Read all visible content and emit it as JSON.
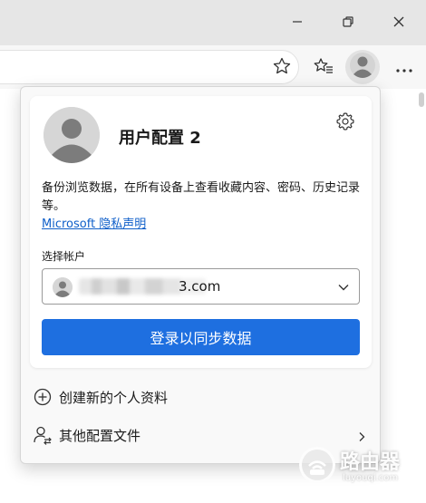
{
  "window": {
    "minimize_icon": "minimize-icon",
    "restore_icon": "restore-icon",
    "close_icon": "close-icon"
  },
  "toolbar": {
    "favorite_icon": "star-icon",
    "favorites_list_icon": "favorites-list-icon",
    "profile_icon": "avatar-icon",
    "more_icon": "more-icon"
  },
  "profile_panel": {
    "profile_name": "用户配置 2",
    "description": "备份浏览数据，在所有设备上查看收藏内容、密码、历史记录等。",
    "privacy_link": "Microsoft 隐私声明",
    "choose_account_label": "选择帐户",
    "account_suffix": "3.com",
    "signin_button": "登录以同步数据",
    "accent_color": "#1e6fe0"
  },
  "menu": {
    "items": [
      {
        "label": "创建新的个人资料",
        "icon": "add-circle-icon"
      },
      {
        "label": "其他配置文件",
        "icon": "people-switch-icon"
      }
    ]
  },
  "watermark": {
    "title": "路由器",
    "subtitle": "luyouqi.com"
  }
}
